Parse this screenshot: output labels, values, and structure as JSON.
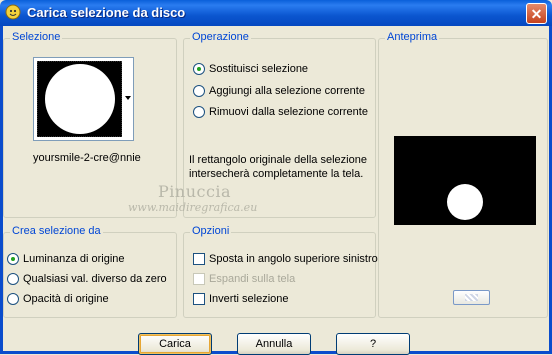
{
  "window": {
    "title": "Carica selezione da disco",
    "close_glyph": "✕"
  },
  "selezione": {
    "title": "Selezione",
    "filename": "yoursmile-2-cre@nnie"
  },
  "operazione": {
    "title": "Operazione",
    "options": [
      {
        "label": "Sostituisci selezione",
        "selected": true
      },
      {
        "label": "Aggiungi alla selezione corrente",
        "selected": false
      },
      {
        "label": "Rimuovi dalla selezione corrente",
        "selected": false
      }
    ],
    "info": "Il rettangolo originale della selezione intersecherà completamente la tela."
  },
  "anteprima": {
    "title": "Anteprima"
  },
  "crea": {
    "title": "Crea selezione da",
    "options": [
      {
        "label": "Luminanza di origine",
        "selected": true
      },
      {
        "label": "Qualsiasi val. diverso da zero",
        "selected": false
      },
      {
        "label": "Opacità di origine",
        "selected": false
      }
    ]
  },
  "opzioni": {
    "title": "Opzioni",
    "items": [
      {
        "label": "Sposta in angolo superiore sinistro",
        "checked": false,
        "enabled": true
      },
      {
        "label": "Espandi sulla tela",
        "checked": false,
        "enabled": false
      },
      {
        "label": "Inverti selezione",
        "checked": false,
        "enabled": true
      }
    ]
  },
  "buttons": {
    "load": "Carica",
    "cancel": "Annulla",
    "help": "?"
  },
  "watermark": {
    "line1": "Pinuccia",
    "line2": "www.maidiregrafica.eu"
  },
  "colors": {
    "title_bar": "#0a5fd9",
    "group_title": "#0046d5",
    "dialog_bg": "#ece9d8"
  }
}
